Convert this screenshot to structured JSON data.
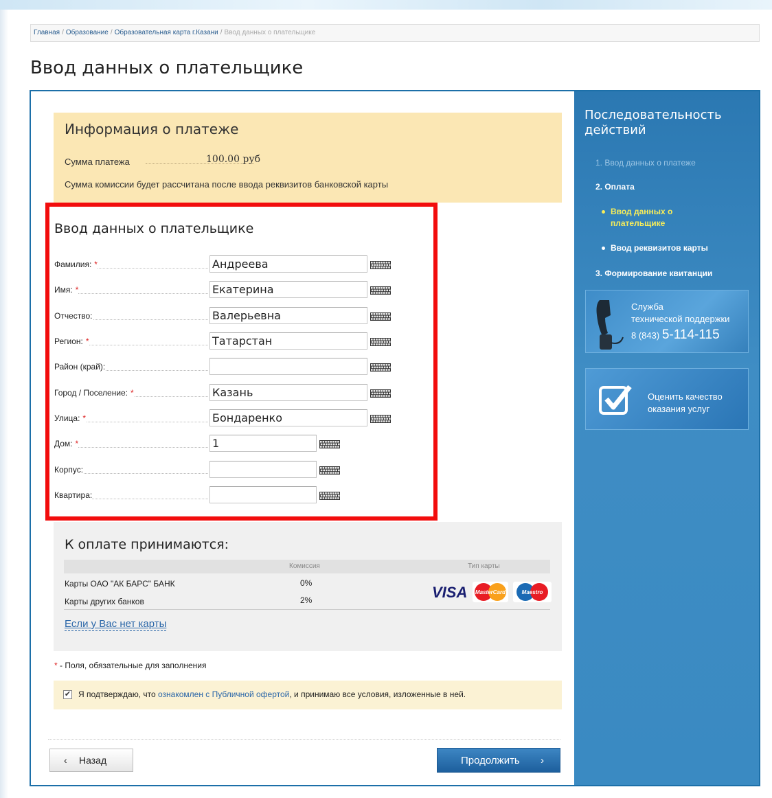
{
  "breadcrumb": {
    "items": [
      "Главная",
      "Образование",
      "Образовательная карта г.Казани"
    ],
    "current": "Ввод данных о плательщике",
    "separator": "/"
  },
  "page_title": "Ввод данных о плательщике",
  "payment_info": {
    "title": "Информация о платеже",
    "sum_label": "Сумма платежа",
    "sum_value": "100.00 руб",
    "commission_note": "Сумма комиссии будет рассчитана после ввода реквизитов банковской карты"
  },
  "form": {
    "title": "Ввод данных о плательщике",
    "required_mark": "*",
    "fields": [
      {
        "label": "Фамилия:",
        "required": true,
        "value": "Андреева"
      },
      {
        "label": "Имя:",
        "required": true,
        "value": "Екатерина"
      },
      {
        "label": "Отчество:",
        "required": false,
        "value": "Валерьевна"
      },
      {
        "label": "Регион:",
        "required": true,
        "value": "Татарстан"
      },
      {
        "label": "Район (край):",
        "required": false,
        "value": ""
      },
      {
        "label": "Город / Поселение:",
        "required": true,
        "value": "Казань"
      },
      {
        "label": "Улица:",
        "required": true,
        "value": "Бондаренко"
      },
      {
        "label": "Дом:",
        "required": true,
        "value": "1"
      },
      {
        "label": "Корпус:",
        "required": false,
        "value": ""
      },
      {
        "label": "Квартира:",
        "required": false,
        "value": ""
      }
    ],
    "keyboard_icon": "virtual-keyboard-icon"
  },
  "accepted": {
    "title": "К оплате принимаются:",
    "col_commission": "Комиссия",
    "col_card_type": "Тип карты",
    "rows": [
      {
        "name": "Карты ОАО \"АК БАРС\" БАНК",
        "commission": "0%"
      },
      {
        "name": "Карты других банков",
        "commission": "2%"
      }
    ],
    "cards": {
      "visa": "VISA",
      "mastercard": "MasterCard",
      "maestro": "Maestro"
    },
    "no_card_link": "Если у Вас нет карты"
  },
  "required_note": {
    "mark": "*",
    "text": "- Поля, обязательные для заполнения"
  },
  "confirm": {
    "checked": true,
    "check_glyph": "✔",
    "text_before": "Я подтверждаю, что",
    "link": "ознакомлен с Публичной офертой",
    "text_after": ", и принимаю все условия, изложенные в ней."
  },
  "buttons": {
    "back": "Назад",
    "back_icon": "‹",
    "next": "Продолжить",
    "next_icon": "›"
  },
  "sidebar": {
    "title": "Последовательность действий",
    "steps": [
      {
        "text": "1. Ввод данных о платеже",
        "state": "done"
      },
      {
        "text": "2. Оплата",
        "state": "current"
      },
      {
        "text": "Ввод данных о",
        "state": "active"
      },
      {
        "text": "плательщике",
        "state": "active"
      },
      {
        "text": "Ввод реквизитов карты",
        "state": "pending"
      },
      {
        "text": "3. Формирование квитанции",
        "state": "pending"
      }
    ],
    "support": {
      "line1": "Служба",
      "line2": "технической поддержки",
      "code": "8 (843)",
      "number": "5-114-115"
    },
    "quality": {
      "line1": "Оценить качество",
      "line2": "оказания услуг"
    }
  },
  "colors": {
    "sidebar_blue": "#3a8ac2",
    "required_red": "#d22",
    "highlight_red": "#f20d0d",
    "active_step_yellow": "#f6ec5a",
    "payinfo_bg": "#fbe7b4"
  }
}
